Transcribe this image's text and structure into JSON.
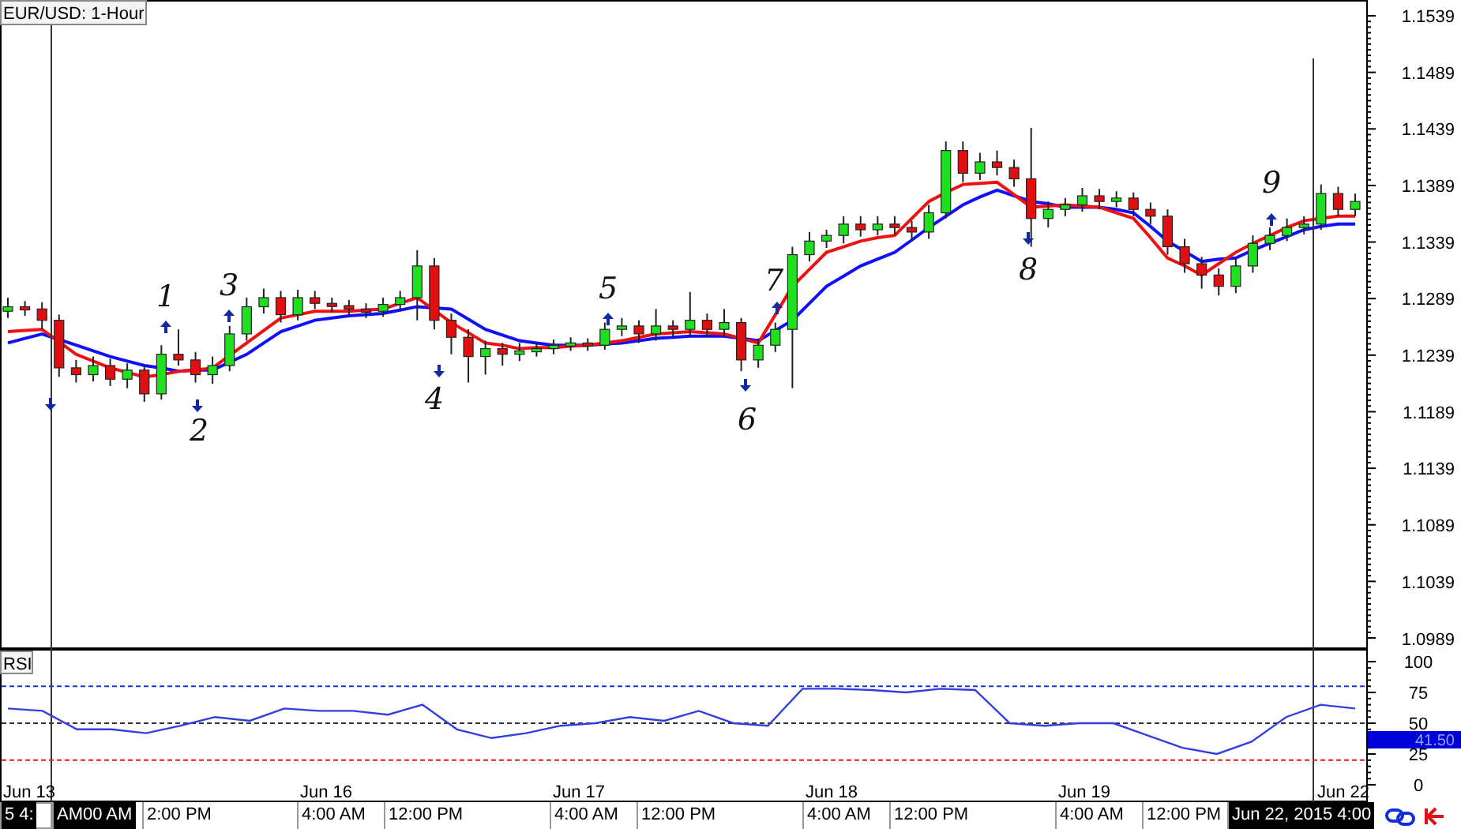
{
  "chart_title": "EUR/USD: 1-Hour",
  "price_chart": {
    "chart_data": {
      "type": "candlestick",
      "ylim": [
        1.0981,
        1.1553
      ],
      "yticks": [
        1.1539,
        1.1489,
        1.1439,
        1.1389,
        1.1339,
        1.1289,
        1.1239,
        1.1189,
        1.1139,
        1.1089,
        1.1039,
        1.0989
      ],
      "ohlc": [
        [
          1.1278,
          1.129,
          1.1272,
          1.1282
        ],
        [
          1.1282,
          1.1287,
          1.1274,
          1.128
        ],
        [
          1.128,
          1.1286,
          1.1262,
          1.127
        ],
        [
          1.127,
          1.1275,
          1.122,
          1.1228
        ],
        [
          1.1228,
          1.1235,
          1.1215,
          1.1222
        ],
        [
          1.1222,
          1.1238,
          1.1216,
          1.123
        ],
        [
          1.123,
          1.1236,
          1.1212,
          1.1218
        ],
        [
          1.1218,
          1.1232,
          1.121,
          1.1226
        ],
        [
          1.1226,
          1.123,
          1.1198,
          1.1205
        ],
        [
          1.1205,
          1.1248,
          1.12,
          1.124
        ],
        [
          1.124,
          1.1262,
          1.123,
          1.1235
        ],
        [
          1.1235,
          1.1242,
          1.1215,
          1.1222
        ],
        [
          1.1222,
          1.1238,
          1.1214,
          1.123
        ],
        [
          1.123,
          1.1265,
          1.1225,
          1.1258
        ],
        [
          1.1258,
          1.129,
          1.1252,
          1.1282
        ],
        [
          1.1282,
          1.1298,
          1.1276,
          1.129
        ],
        [
          1.129,
          1.1296,
          1.1268,
          1.1275
        ],
        [
          1.1275,
          1.1297,
          1.127,
          1.129
        ],
        [
          1.129,
          1.1296,
          1.128,
          1.1285
        ],
        [
          1.1285,
          1.129,
          1.1277,
          1.1283
        ],
        [
          1.1283,
          1.1288,
          1.1274,
          1.128
        ],
        [
          1.128,
          1.1285,
          1.1272,
          1.1278
        ],
        [
          1.1278,
          1.129,
          1.1273,
          1.1284
        ],
        [
          1.1284,
          1.1296,
          1.1279,
          1.129
        ],
        [
          1.129,
          1.1332,
          1.127,
          1.1318
        ],
        [
          1.1318,
          1.1325,
          1.1262,
          1.127
        ],
        [
          1.127,
          1.1276,
          1.124,
          1.1255
        ],
        [
          1.1255,
          1.1262,
          1.1215,
          1.1238
        ],
        [
          1.1238,
          1.1252,
          1.1222,
          1.1245
        ],
        [
          1.1245,
          1.125,
          1.123,
          1.124
        ],
        [
          1.124,
          1.125,
          1.1234,
          1.1243
        ],
        [
          1.1243,
          1.125,
          1.1238,
          1.1245
        ],
        [
          1.1245,
          1.1253,
          1.124,
          1.1248
        ],
        [
          1.1248,
          1.1255,
          1.1243,
          1.125
        ],
        [
          1.125,
          1.1254,
          1.1243,
          1.1248
        ],
        [
          1.1248,
          1.1268,
          1.1244,
          1.1262
        ],
        [
          1.1262,
          1.1272,
          1.1256,
          1.1265
        ],
        [
          1.1265,
          1.127,
          1.125,
          1.1258
        ],
        [
          1.1258,
          1.128,
          1.1252,
          1.1265
        ],
        [
          1.1265,
          1.127,
          1.1255,
          1.1262
        ],
        [
          1.1262,
          1.1295,
          1.1256,
          1.127
        ],
        [
          1.127,
          1.1276,
          1.1255,
          1.1262
        ],
        [
          1.1262,
          1.128,
          1.1256,
          1.1268
        ],
        [
          1.1268,
          1.1272,
          1.1225,
          1.1235
        ],
        [
          1.1235,
          1.1254,
          1.1228,
          1.1248
        ],
        [
          1.1248,
          1.1268,
          1.1242,
          1.1262
        ],
        [
          1.1262,
          1.1335,
          1.121,
          1.1328
        ],
        [
          1.1328,
          1.1348,
          1.1322,
          1.134
        ],
        [
          1.134,
          1.135,
          1.1334,
          1.1345
        ],
        [
          1.1345,
          1.1362,
          1.1338,
          1.1355
        ],
        [
          1.1355,
          1.1362,
          1.1344,
          1.135
        ],
        [
          1.135,
          1.1362,
          1.1345,
          1.1355
        ],
        [
          1.1355,
          1.1362,
          1.1346,
          1.1352
        ],
        [
          1.1352,
          1.1358,
          1.134,
          1.1348
        ],
        [
          1.1348,
          1.1372,
          1.1342,
          1.1365
        ],
        [
          1.1365,
          1.1428,
          1.136,
          1.142
        ],
        [
          1.142,
          1.1428,
          1.1392,
          1.14
        ],
        [
          1.14,
          1.1418,
          1.1394,
          1.141
        ],
        [
          1.141,
          1.142,
          1.1398,
          1.1405
        ],
        [
          1.1405,
          1.1412,
          1.1388,
          1.1395
        ],
        [
          1.1395,
          1.144,
          1.1335,
          1.136
        ],
        [
          1.136,
          1.1375,
          1.1352,
          1.1368
        ],
        [
          1.1368,
          1.1378,
          1.1362,
          1.1372
        ],
        [
          1.1372,
          1.1387,
          1.1366,
          1.138
        ],
        [
          1.138,
          1.1386,
          1.1368,
          1.1375
        ],
        [
          1.1375,
          1.1384,
          1.137,
          1.1378
        ],
        [
          1.1378,
          1.1383,
          1.1362,
          1.1368
        ],
        [
          1.1368,
          1.1374,
          1.1355,
          1.1362
        ],
        [
          1.1362,
          1.1368,
          1.1328,
          1.1335
        ],
        [
          1.1335,
          1.1342,
          1.1312,
          1.132
        ],
        [
          1.132,
          1.1326,
          1.1298,
          1.131
        ],
        [
          1.131,
          1.1316,
          1.1292,
          1.13
        ],
        [
          1.13,
          1.1325,
          1.1294,
          1.1318
        ],
        [
          1.1318,
          1.1345,
          1.1312,
          1.1338
        ],
        [
          1.1338,
          1.1352,
          1.1332,
          1.1345
        ],
        [
          1.1345,
          1.136,
          1.134,
          1.1352
        ],
        [
          1.1352,
          1.1362,
          1.1346,
          1.1355
        ],
        [
          1.1355,
          1.139,
          1.135,
          1.1382
        ],
        [
          1.1382,
          1.1388,
          1.1362,
          1.1368
        ],
        [
          1.1368,
          1.1382,
          1.1362,
          1.1375
        ]
      ]
    }
  },
  "moving_averages": {
    "chart_data": {
      "type": "line",
      "ylim": [
        1.0981,
        1.1553
      ],
      "series": [
        {
          "color": "#f01010",
          "values": [
            1.126,
            1.1261,
            1.1262,
            1.1251,
            1.124,
            1.1234,
            1.1228,
            1.1224,
            1.122,
            1.1222,
            1.1225,
            1.1226,
            1.1228,
            1.1239,
            1.125,
            1.1261,
            1.1272,
            1.1275,
            1.1278,
            1.1278,
            1.1278,
            1.1279,
            1.128,
            1.1285,
            1.129,
            1.1279,
            1.1268,
            1.1259,
            1.125,
            1.1248,
            1.1245,
            1.1246,
            1.1246,
            1.1247,
            1.1248,
            1.125,
            1.1252,
            1.1255,
            1.1258,
            1.1259,
            1.126,
            1.1259,
            1.1258,
            1.1254,
            1.125,
            1.1275,
            1.13,
            1.1315,
            1.133,
            1.1335,
            1.134,
            1.1343,
            1.1345,
            1.136,
            1.1375,
            1.1383,
            1.139,
            1.1391,
            1.1392,
            1.1381,
            1.137,
            1.1371,
            1.1372,
            1.1371,
            1.137,
            1.1365,
            1.136,
            1.1343,
            1.1325,
            1.1318,
            1.131,
            1.132,
            1.133,
            1.1338,
            1.1345,
            1.1352,
            1.1358,
            1.136,
            1.1362,
            1.1362
          ]
        },
        {
          "color": "#1010ff",
          "values": [
            1.125,
            1.1254,
            1.1258,
            1.1253,
            1.1248,
            1.1243,
            1.1238,
            1.1234,
            1.123,
            1.1228,
            1.1225,
            1.1226,
            1.1226,
            1.1233,
            1.124,
            1.125,
            1.126,
            1.1265,
            1.127,
            1.1272,
            1.1274,
            1.1275,
            1.1276,
            1.1279,
            1.1282,
            1.1281,
            1.128,
            1.1271,
            1.1262,
            1.1257,
            1.1252,
            1.125,
            1.1248,
            1.1248,
            1.1248,
            1.1249,
            1.125,
            1.1252,
            1.1254,
            1.1255,
            1.1256,
            1.1256,
            1.1256,
            1.1254,
            1.1252,
            1.1261,
            1.127,
            1.1285,
            1.13,
            1.1309,
            1.1318,
            1.1324,
            1.133,
            1.1341,
            1.1352,
            1.1362,
            1.1372,
            1.1379,
            1.1385,
            1.138,
            1.1375,
            1.1373,
            1.137,
            1.137,
            1.137,
            1.1368,
            1.1365,
            1.1353,
            1.134,
            1.1331,
            1.1322,
            1.1324,
            1.1325,
            1.1332,
            1.1338,
            1.1344,
            1.135,
            1.1353,
            1.1355,
            1.1355
          ]
        }
      ]
    }
  },
  "annotations": [
    {
      "kind": "down"
    },
    {
      "kind": "up",
      "label": "1"
    },
    {
      "kind": "down",
      "label": "2"
    },
    {
      "kind": "up",
      "label": "3"
    },
    {
      "kind": "down",
      "label": "4"
    },
    {
      "kind": "up",
      "label": "5"
    },
    {
      "kind": "down",
      "label": "6"
    },
    {
      "kind": "up",
      "label": "7"
    },
    {
      "kind": "down",
      "label": "8"
    },
    {
      "kind": "up",
      "label": "9"
    }
  ],
  "rsi": {
    "label": "RSI",
    "value_tag": "41.50",
    "chart_data": {
      "type": "line",
      "ylim": [
        -12.8,
        109
      ],
      "yticks": [
        0,
        25,
        50,
        75,
        100
      ],
      "series": [
        {
          "color": "#3040e0",
          "values": [
            62,
            60,
            45,
            45,
            42,
            48,
            55,
            52,
            62,
            60,
            60,
            57,
            65,
            45,
            38,
            42,
            48,
            50,
            55,
            52,
            60,
            50,
            48,
            78,
            78,
            77,
            75,
            78,
            77,
            50,
            48,
            50,
            50,
            40,
            30,
            25,
            35,
            55,
            65,
            62
          ]
        }
      ]
    }
  },
  "date_labels": [
    "Jun 13",
    "Jun 16",
    "Jun 17",
    "Jun 18",
    "Jun 19",
    "Jun 22"
  ],
  "time_bar": [
    {
      "text": "5 4:",
      "highlighted": true
    },
    {
      "text": "AM00 AM",
      "highlighted": true
    },
    {
      "text": "2:00 PM",
      "highlighted": false
    },
    {
      "text": "4:00 AM",
      "highlighted": false
    },
    {
      "text": "12:00 PM",
      "highlighted": false
    },
    {
      "text": "4:00 AM",
      "highlighted": false
    },
    {
      "text": "12:00 PM",
      "highlighted": false
    },
    {
      "text": "4:00 AM",
      "highlighted": false
    },
    {
      "text": "12:00 PM",
      "highlighted": false
    },
    {
      "text": "4:00 AM",
      "highlighted": false
    },
    {
      "text": "12:00 PM",
      "highlighted": false
    },
    {
      "text": "Jun 22, 2015 4:00",
      "highlighted": true
    }
  ]
}
